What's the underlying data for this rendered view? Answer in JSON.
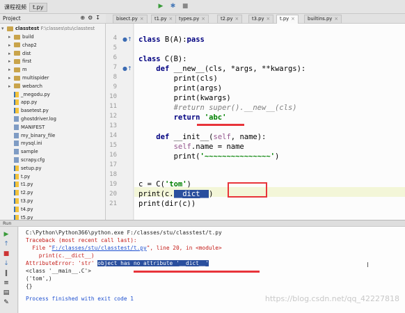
{
  "topbar": {
    "crumb1": "课程视频",
    "crumb2": "t.py"
  },
  "project": {
    "label": "Project",
    "root_name": "classtest",
    "root_path": "F:\\classes\\stu\\classtest"
  },
  "tree": [
    {
      "name": "build",
      "type": "folder"
    },
    {
      "name": "chap2",
      "type": "folder"
    },
    {
      "name": "dist",
      "type": "folder"
    },
    {
      "name": "first",
      "type": "folder"
    },
    {
      "name": "m",
      "type": "folder"
    },
    {
      "name": "multispider",
      "type": "folder"
    },
    {
      "name": "webarch",
      "type": "folder"
    },
    {
      "name": "_megodu.py",
      "type": "py"
    },
    {
      "name": "app.py",
      "type": "py"
    },
    {
      "name": "basetest.py",
      "type": "py"
    },
    {
      "name": "ghostdriver.log",
      "type": "file"
    },
    {
      "name": "MANIFEST",
      "type": "file"
    },
    {
      "name": "my_binary_file",
      "type": "file"
    },
    {
      "name": "mysql.ini",
      "type": "file"
    },
    {
      "name": "sample",
      "type": "file"
    },
    {
      "name": "scrapy.cfg",
      "type": "file"
    },
    {
      "name": "setup.py",
      "type": "py"
    },
    {
      "name": "t.py",
      "type": "py"
    },
    {
      "name": "t1.py",
      "type": "py"
    },
    {
      "name": "t2.py",
      "type": "py"
    },
    {
      "name": "t3.py",
      "type": "py"
    },
    {
      "name": "t4.py",
      "type": "py"
    },
    {
      "name": "t5.py",
      "type": "py"
    }
  ],
  "tabs": [
    {
      "label": "bisect.py",
      "active": false
    },
    {
      "label": "t1.py",
      "active": false
    },
    {
      "label": "types.py",
      "active": false
    },
    {
      "label": "t2.py",
      "active": false
    },
    {
      "label": "t3.py",
      "active": false
    },
    {
      "label": "t.py",
      "active": true
    },
    {
      "label": "builtins.py",
      "active": false
    }
  ],
  "code": {
    "line_numbers": [
      "4",
      "5",
      "6",
      "7",
      "8",
      "9",
      "10",
      "11",
      "12",
      "13",
      "14",
      "15",
      "16",
      "17",
      "18",
      "19",
      "20",
      "21"
    ],
    "l4_kw": "class",
    "l4_rest": " B(A):",
    "l4_kw2": "pass",
    "l6_kw": "class",
    "l6_rest": " C(B):",
    "l7_kw": "def",
    "l7_name": " __new__",
    "l7_rest": "(cls, *args, **kwargs):",
    "l8": "print(cls)",
    "l9": "print(args)",
    "l10": "print(kwargs)",
    "l11": "#return super().__new__(cls)",
    "l12_kw": "return",
    "l12_str": "'abc'",
    "l14_kw": "def",
    "l14_name": " __init__",
    "l14_open": "(",
    "l14_self": "self",
    "l14_rest": ", name):",
    "l15_self": "self",
    "l15_rest": ".name = name",
    "l16_pre": "print(",
    "l16_str": "'~~~~~~~~~~~~~~~'",
    "l16_post": ")",
    "l19_pre": "c = C(",
    "l19_str": "'tom'",
    "l19_post": ")",
    "l20_pre": "print(c.",
    "l20_sel": "__dict__",
    "l20_post": ")",
    "l21": "print(dir(c))"
  },
  "run": {
    "label": "Run",
    "cmd": "C:\\Python\\Python366\\python.exe F:/classes/stu/classtest/t.py",
    "tb1": "Traceback (most recent call last):",
    "tb2_pre": "  File \"",
    "tb2_link": "F:/classes/stu/classtest/t.py",
    "tb2_post": "\", line 20, in <module>",
    "tb3": "    print(c.__dict__)",
    "err_pre": "AttributeError: 'str' ",
    "err_sel": "object has no attribute '__dict__'",
    "out1": "<class '__main__.C'>",
    "out2": "('tom',)",
    "out3": "{}",
    "finish": "Process finished with exit code 1"
  },
  "watermark": "https://blog.csdn.net/qq_42227818",
  "colors": {
    "keyword": "#000080",
    "string": "#008000",
    "error": "#c41a16",
    "highlight_red": "#e8343a",
    "selection": "#2a4f9e"
  }
}
